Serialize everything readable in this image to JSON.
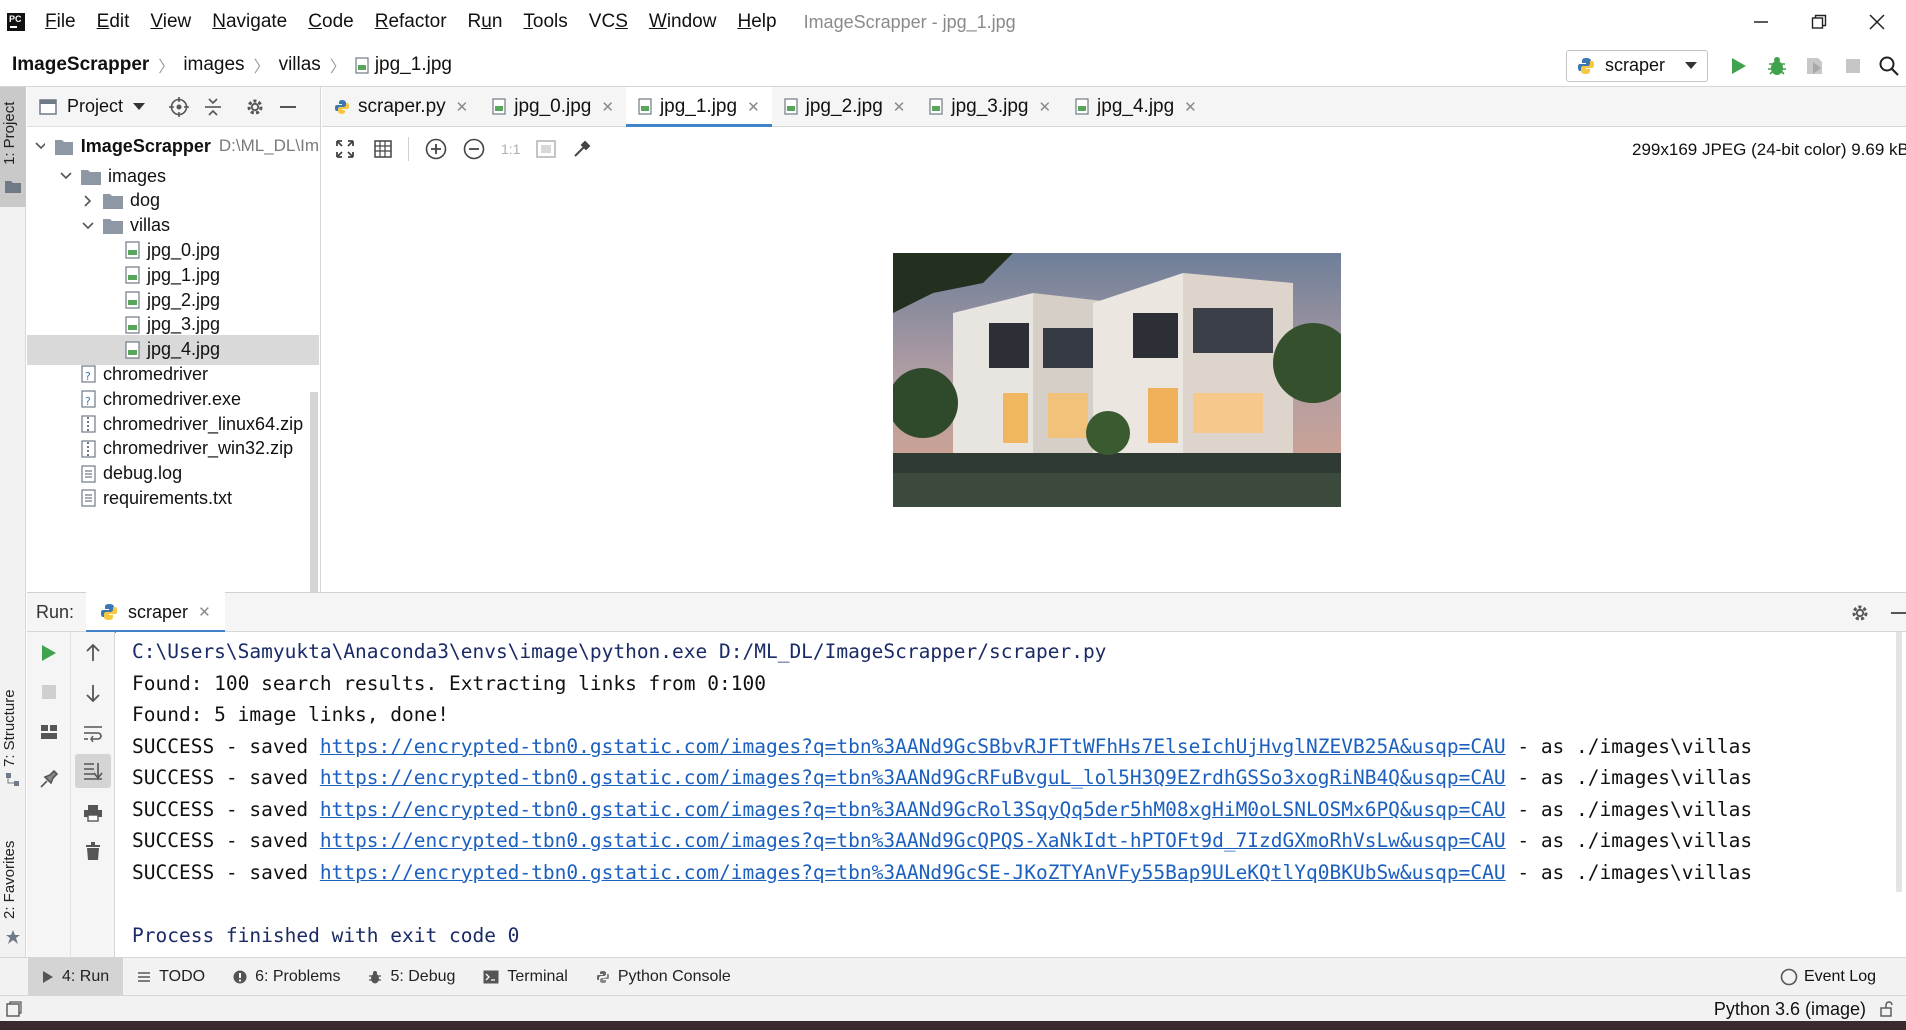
{
  "window": {
    "title": "ImageScrapper - jpg_1.jpg",
    "app_logo_text": "PC"
  },
  "menu": [
    "File",
    "Edit",
    "View",
    "Navigate",
    "Code",
    "Refactor",
    "Run",
    "Tools",
    "VCS",
    "Window",
    "Help"
  ],
  "menu_mnemonics": [
    "F",
    "E",
    "V",
    "N",
    "C",
    "R",
    "u",
    "T",
    "S",
    "W",
    "H"
  ],
  "breadcrumb": [
    "ImageScrapper",
    "images",
    "villas",
    "jpg_1.jpg"
  ],
  "run_config": {
    "name": "scraper"
  },
  "project_panel": {
    "title": "Project",
    "root": {
      "name": "ImageScrapper",
      "path": "D:\\ML_DL\\Im"
    },
    "items": [
      {
        "label": "images",
        "type": "folder",
        "state": "expanded"
      },
      {
        "label": "dog",
        "type": "folder",
        "state": "collapsed"
      },
      {
        "label": "villas",
        "type": "folder",
        "state": "expanded"
      },
      {
        "label": "jpg_0.jpg",
        "type": "image"
      },
      {
        "label": "jpg_1.jpg",
        "type": "image"
      },
      {
        "label": "jpg_2.jpg",
        "type": "image"
      },
      {
        "label": "jpg_3.jpg",
        "type": "image"
      },
      {
        "label": "jpg_4.jpg",
        "type": "image",
        "selected": true
      },
      {
        "label": "chromedriver",
        "type": "unknown"
      },
      {
        "label": "chromedriver.exe",
        "type": "unknown"
      },
      {
        "label": "chromedriver_linux64.zip",
        "type": "archive"
      },
      {
        "label": "chromedriver_win32.zip",
        "type": "archive"
      },
      {
        "label": "debug.log",
        "type": "text"
      },
      {
        "label": "requirements.txt",
        "type": "text"
      }
    ]
  },
  "editor_tabs": [
    {
      "label": "scraper.py",
      "type": "python"
    },
    {
      "label": "jpg_0.jpg",
      "type": "image"
    },
    {
      "label": "jpg_1.jpg",
      "type": "image",
      "active": true
    },
    {
      "label": "jpg_2.jpg",
      "type": "image"
    },
    {
      "label": "jpg_3.jpg",
      "type": "image"
    },
    {
      "label": "jpg_4.jpg",
      "type": "image"
    }
  ],
  "image_viewer": {
    "info": "299x169 JPEG (24-bit color) 9.69 kB",
    "zoom_actual_label": "1:1"
  },
  "left_strip": {
    "project": "1: Project",
    "structure": "7: Structure",
    "favorites": "2: Favorites"
  },
  "run_panel": {
    "label": "Run:",
    "tab": "scraper",
    "console": {
      "command": "C:\\Users\\Samyukta\\Anaconda3\\envs\\image\\python.exe D:/ML_DL/ImageScrapper/scraper.py",
      "lines": [
        "Found: 100 search results. Extracting links from 0:100",
        "Found: 5 image links, done!"
      ],
      "success_prefix": "SUCCESS - saved ",
      "success_suffix": " - as ./images\\villas",
      "saved_urls": [
        "https://encrypted-tbn0.gstatic.com/images?q=tbn%3AANd9GcSBbvRJFTtWFhHs7ElseIchUjHvglNZEVB25A&usqp=CAU",
        "https://encrypted-tbn0.gstatic.com/images?q=tbn%3AANd9GcRFuBvguL_lol5H3Q9EZrdhGSSo3xogRiNB4Q&usqp=CAU",
        "https://encrypted-tbn0.gstatic.com/images?q=tbn%3AANd9GcRol3SqyQq5der5hM08xgHiM0oLSNLOSMx6PQ&usqp=CAU",
        "https://encrypted-tbn0.gstatic.com/images?q=tbn%3AANd9GcQPQS-XaNkIdt-hPTOFt9d_7IzdGXmoRhVsLw&usqp=CAU",
        "https://encrypted-tbn0.gstatic.com/images?q=tbn%3AANd9GcSE-JKoZTYAnVFy55Bap9ULeKQtlYq0BKUbSw&usqp=CAU"
      ],
      "exit": "Process finished with exit code 0"
    }
  },
  "bottom_tabs": [
    {
      "label": "4: Run",
      "icon": "run-icon",
      "active": true
    },
    {
      "label": "TODO",
      "icon": "list-icon"
    },
    {
      "label": "6: Problems",
      "icon": "problems-icon"
    },
    {
      "label": "5: Debug",
      "icon": "bug-icon"
    },
    {
      "label": "Terminal",
      "icon": "terminal-icon"
    },
    {
      "label": "Python Console",
      "icon": "python-icon"
    }
  ],
  "event_log": "Event Log",
  "status": {
    "interpreter": "Python 3.6 (image)"
  },
  "colors": {
    "accent": "#4083c9",
    "run_green": "#3fa34d",
    "link": "#1b5fbf",
    "selection": "#d9d9d9"
  }
}
